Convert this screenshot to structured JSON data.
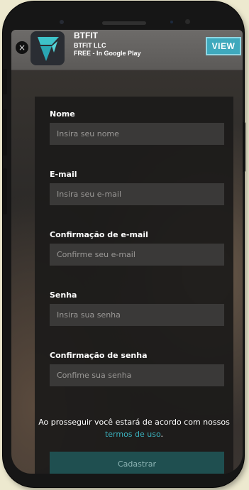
{
  "banner": {
    "close_glyph": "×",
    "app_name": "BTFIT",
    "developer": "BTFIT LLC",
    "availability": "FREE - In Google Play",
    "view_label": "VIEW",
    "icon": "btfit-logo-icon",
    "accent_color": "#3fa9bd"
  },
  "form": {
    "name": {
      "label": "Nome",
      "placeholder": "Insira seu nome"
    },
    "email": {
      "label": "E-mail",
      "placeholder": "Insira seu e-mail"
    },
    "email_confirm": {
      "label": "Confirmação de e-mail",
      "placeholder": "Confirme seu e-mail"
    },
    "password": {
      "label": "Senha",
      "placeholder": "Insira sua senha"
    },
    "password_confirm": {
      "label": "Confirmação de senha",
      "placeholder": "Confime sua senha"
    },
    "terms_text": "Ao prosseguir você estará de acordo com nossos",
    "terms_link": "termos de uso",
    "terms_end": ".",
    "submit_label": "Cadastrar",
    "link_color": "#3bb3bf"
  }
}
